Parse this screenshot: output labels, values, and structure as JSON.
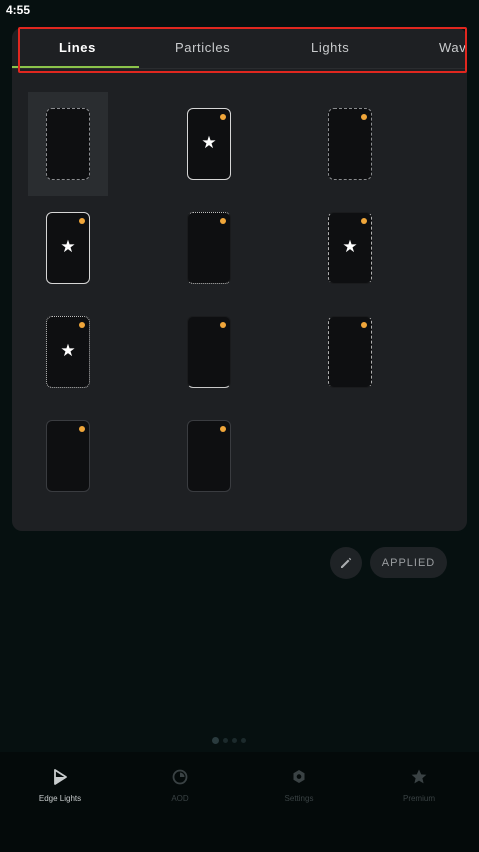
{
  "status_bar": {
    "time": "4:55"
  },
  "tabs": [
    {
      "label": "Lines",
      "active": true
    },
    {
      "label": "Particles",
      "active": false
    },
    {
      "label": "Lights",
      "active": false
    },
    {
      "label": "Wav",
      "active": false
    }
  ],
  "grid": [
    {
      "outline": "dashed-gray",
      "dot": false,
      "star": false,
      "selected": true
    },
    {
      "outline": "solid-white",
      "dot": true,
      "star": true,
      "selected": false
    },
    {
      "outline": "dashed-gray",
      "dot": true,
      "star": false,
      "selected": false
    },
    {
      "outline": "solid-white",
      "dot": true,
      "star": true,
      "selected": false
    },
    {
      "outline": "dotted-top-bottom",
      "dot": true,
      "star": false,
      "selected": false
    },
    {
      "outline": "dashed-sides",
      "dot": true,
      "star": true,
      "selected": false
    },
    {
      "outline": "dotted-white",
      "dot": true,
      "star": true,
      "selected": false
    },
    {
      "outline": "bottom-glow",
      "dot": true,
      "star": false,
      "selected": false
    },
    {
      "outline": "dashed-sides",
      "dot": true,
      "star": false,
      "selected": false
    },
    {
      "outline": "faint",
      "dot": true,
      "star": false,
      "selected": false
    },
    {
      "outline": "faint-sides",
      "dot": true,
      "star": false,
      "selected": false
    }
  ],
  "actions": {
    "edit_icon": "pencil-icon",
    "applied_label": "APPLIED"
  },
  "pager": {
    "count": 4,
    "current": 1
  },
  "bottom_nav": [
    {
      "label": "Edge Lights",
      "icon": "edge-lights-icon",
      "active": true
    },
    {
      "label": "AOD",
      "icon": "aod-icon",
      "active": false
    },
    {
      "label": "Settings",
      "icon": "settings-icon",
      "active": false
    },
    {
      "label": "Premium",
      "icon": "star-icon",
      "active": false
    }
  ],
  "colors": {
    "accent": "#8bc34a",
    "badge": "#f0a63a",
    "highlight": "#e0271f",
    "panel": "#1e2023",
    "background": "#061010"
  }
}
